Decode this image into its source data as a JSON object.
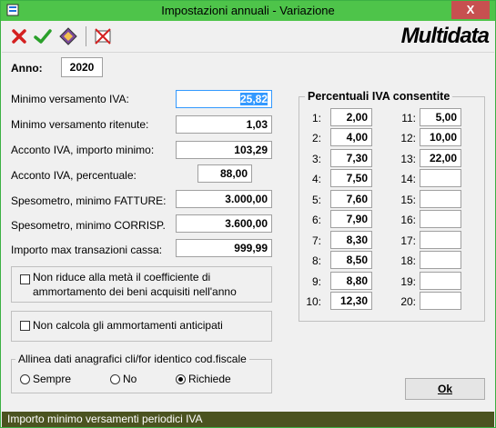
{
  "window": {
    "title": "Impostazioni annuali - Variazione",
    "close_glyph": "X"
  },
  "toolbar": {
    "icons": [
      "cancel-icon",
      "confirm-icon",
      "book-icon",
      "delete-icon"
    ],
    "logo_text": "Multidata"
  },
  "year": {
    "label": "Anno:",
    "value": "2020"
  },
  "fields": [
    {
      "label": "Minimo versamento IVA:",
      "value": "25,82"
    },
    {
      "label": "Minimo versamento ritenute:",
      "value": "1,03"
    },
    {
      "label": "Acconto IVA, importo minimo:",
      "value": "103,29"
    },
    {
      "label": "Acconto IVA, percentuale:",
      "value": "88,00"
    },
    {
      "label": "Spesometro, minimo FATTURE:",
      "value": "3.000,00"
    },
    {
      "label": "Spesometro, minimo CORRISP.",
      "value": "3.600,00"
    },
    {
      "label": "Importo max transazioni cassa:",
      "value": "999,99"
    }
  ],
  "checkboxes": {
    "half_coefficient": {
      "line1": "Non riduce alla metà il coefficiente di",
      "line2": "ammortamento dei beni acquisiti nell'anno",
      "checked": false
    },
    "advance_depreciation": {
      "label": "Non calcola gli ammortamenti anticipati",
      "checked": false
    }
  },
  "align_group": {
    "title": "Allinea dati anagrafici cli/for identico cod.fiscale",
    "options": [
      "Sempre",
      "No",
      "Richiede"
    ],
    "selected": "Richiede"
  },
  "vat": {
    "title": "Percentuali IVA consentite",
    "col1": [
      {
        "n": "1:",
        "v": "2,00"
      },
      {
        "n": "2:",
        "v": "4,00"
      },
      {
        "n": "3:",
        "v": "7,30"
      },
      {
        "n": "4:",
        "v": "7,50"
      },
      {
        "n": "5:",
        "v": "7,60"
      },
      {
        "n": "6:",
        "v": "7,90"
      },
      {
        "n": "7:",
        "v": "8,30"
      },
      {
        "n": "8:",
        "v": "8,50"
      },
      {
        "n": "9:",
        "v": "8,80"
      },
      {
        "n": "10:",
        "v": "12,30"
      }
    ],
    "col2": [
      {
        "n": "11:",
        "v": "5,00"
      },
      {
        "n": "12:",
        "v": "10,00"
      },
      {
        "n": "13:",
        "v": "22,00"
      },
      {
        "n": "14:",
        "v": ""
      },
      {
        "n": "15:",
        "v": ""
      },
      {
        "n": "16:",
        "v": ""
      },
      {
        "n": "17:",
        "v": ""
      },
      {
        "n": "18:",
        "v": ""
      },
      {
        "n": "19:",
        "v": ""
      },
      {
        "n": "20:",
        "v": ""
      }
    ]
  },
  "ok_label": "Ok",
  "status": "Importo minimo versamenti periodici IVA",
  "colors": {
    "titlebar": "#4ec44a",
    "statusbar": "#4b5320",
    "selection": "#3399ff"
  }
}
